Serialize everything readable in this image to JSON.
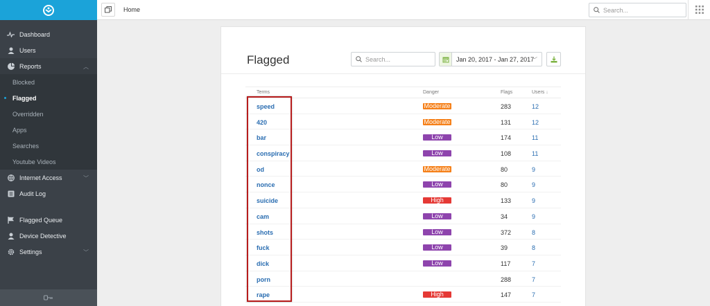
{
  "sidebar": {
    "items": [
      {
        "label": "Dashboard",
        "icon": "pulse-icon"
      },
      {
        "label": "Users",
        "icon": "user-icon"
      },
      {
        "label": "Reports",
        "icon": "pie-chart-icon"
      }
    ],
    "reports_sub": [
      {
        "label": "Blocked"
      },
      {
        "label": "Flagged"
      },
      {
        "label": "Overridden"
      },
      {
        "label": "Apps"
      },
      {
        "label": "Searches"
      },
      {
        "label": "Youtube Videos"
      }
    ],
    "items_after": [
      {
        "label": "Internet Access",
        "icon": "globe-icon"
      },
      {
        "label": "Audit Log",
        "icon": "list-icon"
      }
    ],
    "items_bottom": [
      {
        "label": "Flagged Queue",
        "icon": "flag-icon"
      },
      {
        "label": "Device Detective",
        "icon": "user-icon"
      },
      {
        "label": "Settings",
        "icon": "gear-icon"
      }
    ]
  },
  "topbar": {
    "breadcrumb": "Home",
    "search_placeholder": "Search..."
  },
  "panel": {
    "title": "Flagged",
    "search_placeholder": "Search...",
    "date_range": "Jan 20, 2017 - Jan 27, 2017"
  },
  "table": {
    "headers": {
      "terms": "Terms",
      "danger": "Danger",
      "flags": "Flags",
      "users": "Users"
    },
    "rows": [
      {
        "term": "speed",
        "danger": "Moderate",
        "flags": "283",
        "users": "12"
      },
      {
        "term": "420",
        "danger": "Moderate",
        "flags": "131",
        "users": "12"
      },
      {
        "term": "bar",
        "danger": "Low",
        "flags": "174",
        "users": "11"
      },
      {
        "term": "conspiracy",
        "danger": "Low",
        "flags": "108",
        "users": "11"
      },
      {
        "term": "od",
        "danger": "Moderate",
        "flags": "80",
        "users": "9"
      },
      {
        "term": "nonce",
        "danger": "Low",
        "flags": "80",
        "users": "9"
      },
      {
        "term": "suicide",
        "danger": "High",
        "flags": "133",
        "users": "9"
      },
      {
        "term": "cam",
        "danger": "Low",
        "flags": "34",
        "users": "9"
      },
      {
        "term": "shots",
        "danger": "Low",
        "flags": "372",
        "users": "8"
      },
      {
        "term": "fuck",
        "danger": "Low",
        "flags": "39",
        "users": "8"
      },
      {
        "term": "dick",
        "danger": "Low",
        "flags": "117",
        "users": "7"
      },
      {
        "term": "porn",
        "danger": "",
        "flags": "288",
        "users": "7"
      },
      {
        "term": "rape",
        "danger": "High",
        "flags": "147",
        "users": "7"
      }
    ]
  },
  "colors": {
    "brand": "#1ba3d9",
    "moderate": "#f57f17",
    "low": "#8e44ad",
    "high": "#e53935",
    "highlight": "#b71c1c"
  }
}
